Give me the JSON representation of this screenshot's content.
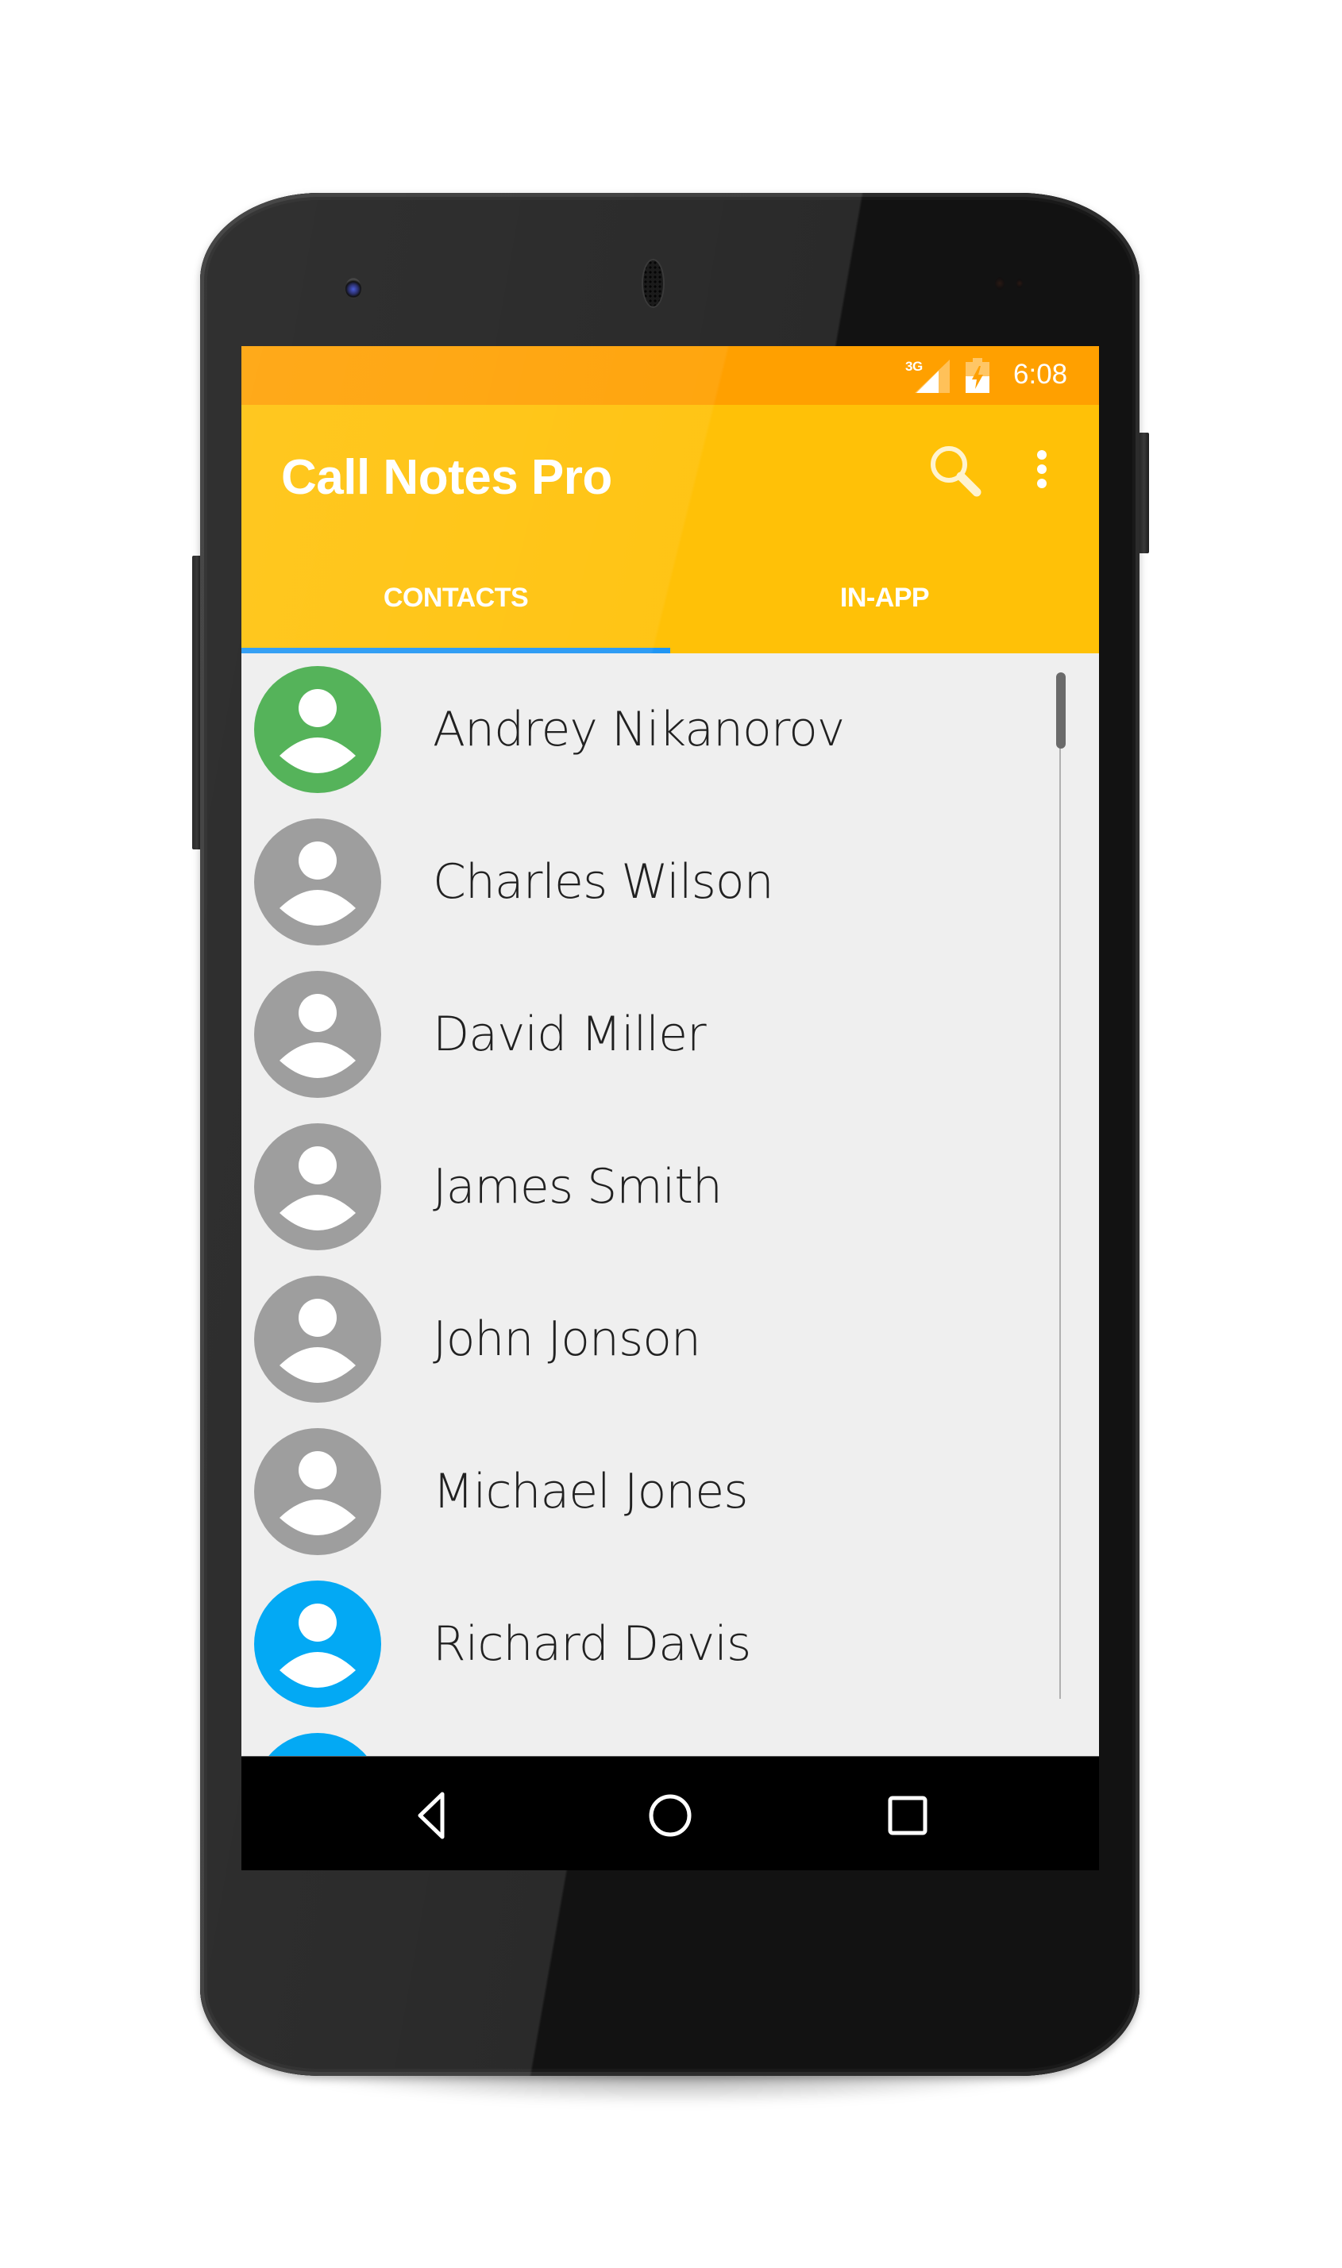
{
  "status_bar": {
    "network_type": "3G",
    "time": "6:08",
    "icons": [
      "signal-icon",
      "battery-charging-icon"
    ]
  },
  "app_bar": {
    "title": "Call Notes Pro",
    "actions": [
      {
        "name": "search",
        "icon": "search-icon"
      },
      {
        "name": "more-options",
        "icon": "overflow-menu-icon"
      }
    ]
  },
  "tabs": [
    {
      "label": "CONTACTS",
      "selected": true
    },
    {
      "label": "IN-APP",
      "selected": false
    }
  ],
  "contacts": [
    {
      "name": "Andrey Nikanorov",
      "avatar_color": "#55b35a"
    },
    {
      "name": "Charles Wilson",
      "avatar_color": "#9e9e9e"
    },
    {
      "name": "David Miller",
      "avatar_color": "#9e9e9e"
    },
    {
      "name": "James Smith",
      "avatar_color": "#9e9e9e"
    },
    {
      "name": "John Jonson",
      "avatar_color": "#9e9e9e"
    },
    {
      "name": "Michael Jones",
      "avatar_color": "#9e9e9e"
    },
    {
      "name": "Richard Davis",
      "avatar_color": "#03a9f4"
    },
    {
      "name": "",
      "avatar_color": "#03a9f4"
    }
  ],
  "scroll": {
    "position_fraction": 0.0
  },
  "navigation_bar": {
    "buttons": [
      {
        "name": "back",
        "icon": "back-triangle-icon"
      },
      {
        "name": "home",
        "icon": "home-circle-icon"
      },
      {
        "name": "recents",
        "icon": "recents-square-icon"
      }
    ]
  },
  "colors": {
    "status_bar": "#ffa000",
    "app_bar": "#ffc107",
    "tab_indicator": "#2196f3",
    "list_background": "#efefef"
  }
}
